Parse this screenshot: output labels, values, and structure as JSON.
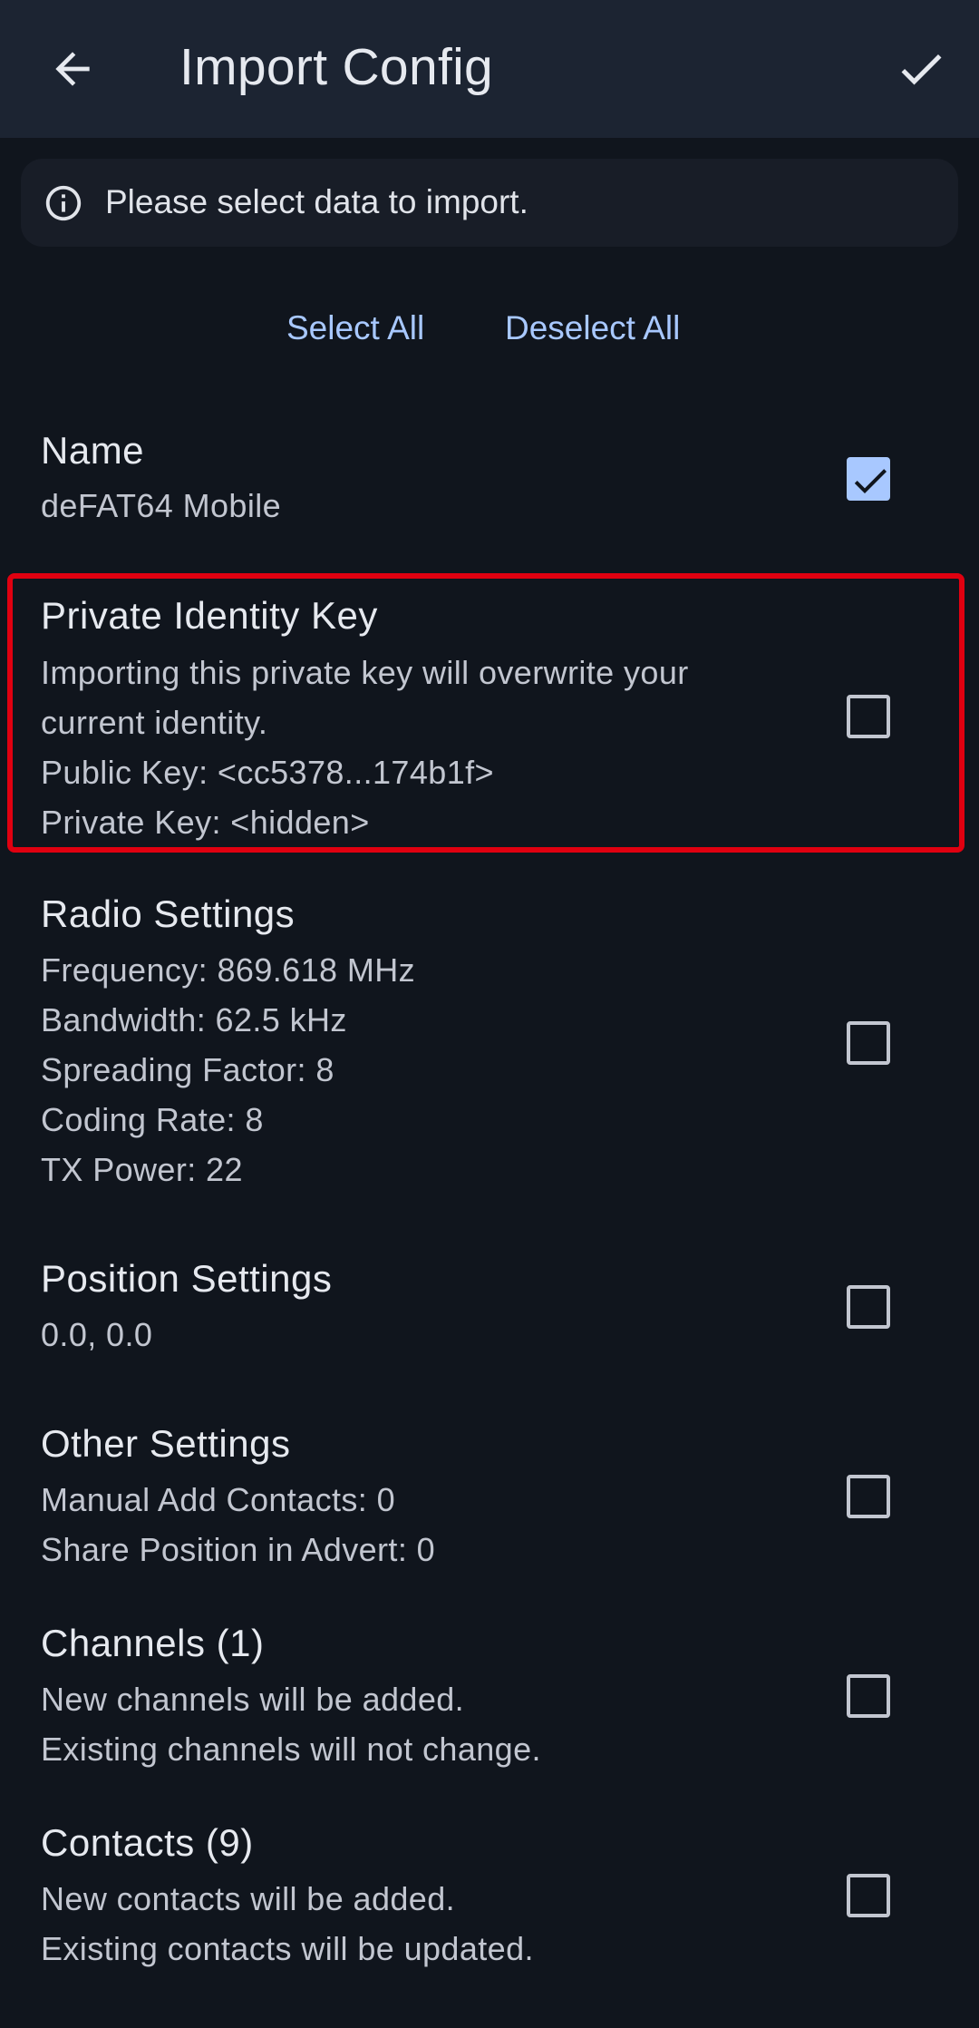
{
  "app_bar": {
    "title": "Import Config",
    "back_icon": "arrow-back-icon",
    "confirm_icon": "check-icon"
  },
  "info": {
    "icon": "info-icon",
    "text": "Please select data to import."
  },
  "actions": {
    "select_all": "Select All",
    "deselect_all": "Deselect All"
  },
  "colors": {
    "accent": "#a8c8ff",
    "background": "#10151d",
    "app_bar": "#1c2432",
    "highlight": "#e00010"
  },
  "items": [
    {
      "title": "Name",
      "lines": [
        "deFAT64 Mobile"
      ],
      "checked": true
    },
    {
      "title": "Private Identity Key",
      "lines": [
        "Importing this private key will overwrite your",
        "current identity.",
        "Public Key: <cc5378...174b1f>",
        "Private Key: <hidden>"
      ],
      "checked": false
    },
    {
      "title": "Radio Settings",
      "lines": [
        "Frequency: 869.618 MHz",
        "Bandwidth: 62.5 kHz",
        "Spreading Factor: 8",
        "Coding Rate: 8",
        "TX Power: 22"
      ],
      "checked": false
    },
    {
      "title": "Position Settings",
      "lines": [
        "0.0, 0.0"
      ],
      "checked": false
    },
    {
      "title": "Other Settings",
      "lines": [
        "Manual Add Contacts: 0",
        "Share Position in Advert: 0"
      ],
      "checked": false
    },
    {
      "title": "Channels (1)",
      "lines": [
        "New channels will be added.",
        "Existing channels will not change."
      ],
      "checked": false
    },
    {
      "title": "Contacts (9)",
      "lines": [
        "New contacts will be added.",
        "Existing contacts will be updated."
      ],
      "checked": false
    }
  ]
}
